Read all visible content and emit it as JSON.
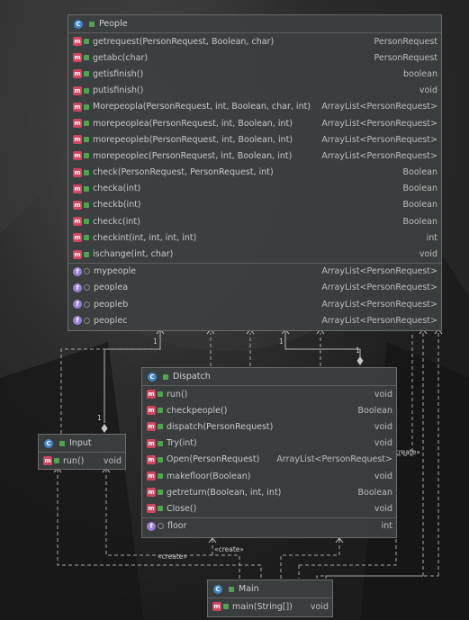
{
  "classes": {
    "people": {
      "name": "People",
      "methods": [
        {
          "name": "getrequest(PersonRequest, Boolean, char)",
          "type": "PersonRequest"
        },
        {
          "name": "getabc(char)",
          "type": "PersonRequest"
        },
        {
          "name": "getisfinish()",
          "type": "boolean"
        },
        {
          "name": "putisfinish()",
          "type": "void"
        },
        {
          "name": "Morepeopla(PersonRequest, int, Boolean, char, int)",
          "type": "ArrayList<PersonRequest>"
        },
        {
          "name": "morepeoplea(PersonRequest, int, Boolean, int)",
          "type": "ArrayList<PersonRequest>"
        },
        {
          "name": "morepeopleb(PersonRequest, int, Boolean, int)",
          "type": "ArrayList<PersonRequest>"
        },
        {
          "name": "morepeoplec(PersonRequest, int, Boolean, int)",
          "type": "ArrayList<PersonRequest>"
        },
        {
          "name": "check(PersonRequest, PersonRequest, int)",
          "type": "Boolean"
        },
        {
          "name": "checka(int)",
          "type": "Boolean"
        },
        {
          "name": "checkb(int)",
          "type": "Boolean"
        },
        {
          "name": "checkc(int)",
          "type": "Boolean"
        },
        {
          "name": "checkint(int, int, int, int)",
          "type": "int"
        },
        {
          "name": "ischange(int, char)",
          "type": "void"
        }
      ],
      "fields": [
        {
          "name": "mypeople",
          "type": "ArrayList<PersonRequest>"
        },
        {
          "name": "peoplea",
          "type": "ArrayList<PersonRequest>"
        },
        {
          "name": "peopleb",
          "type": "ArrayList<PersonRequest>"
        },
        {
          "name": "peoplec",
          "type": "ArrayList<PersonRequest>"
        }
      ]
    },
    "dispatch": {
      "name": "Dispatch",
      "methods": [
        {
          "name": "run()",
          "type": "void"
        },
        {
          "name": "checkpeople()",
          "type": "Boolean"
        },
        {
          "name": "dispatch(PersonRequest)",
          "type": "void"
        },
        {
          "name": "Try(int)",
          "type": "void"
        },
        {
          "name": "Open(PersonRequest)",
          "type": "ArrayList<PersonRequest>"
        },
        {
          "name": "makefloor(Boolean)",
          "type": "void"
        },
        {
          "name": "getreturn(Boolean, int, int)",
          "type": "Boolean"
        },
        {
          "name": "Close()",
          "type": "void"
        }
      ],
      "fields": [
        {
          "name": "floor",
          "type": "int"
        }
      ]
    },
    "input": {
      "name": "Input",
      "methods": [
        {
          "name": "run()",
          "type": "void"
        }
      ]
    },
    "main": {
      "name": "Main",
      "methods": [
        {
          "name": "main(String[])",
          "type": "void"
        }
      ]
    }
  },
  "relations": {
    "create_label": "«create»",
    "mult_one": "1"
  },
  "icons": {
    "class": "class-icon",
    "method": "method-icon",
    "field": "field-icon"
  },
  "colors": {
    "method": "#d2455f",
    "field": "#9b7fd6",
    "class": "#3f86c8",
    "public": "#51a351"
  }
}
